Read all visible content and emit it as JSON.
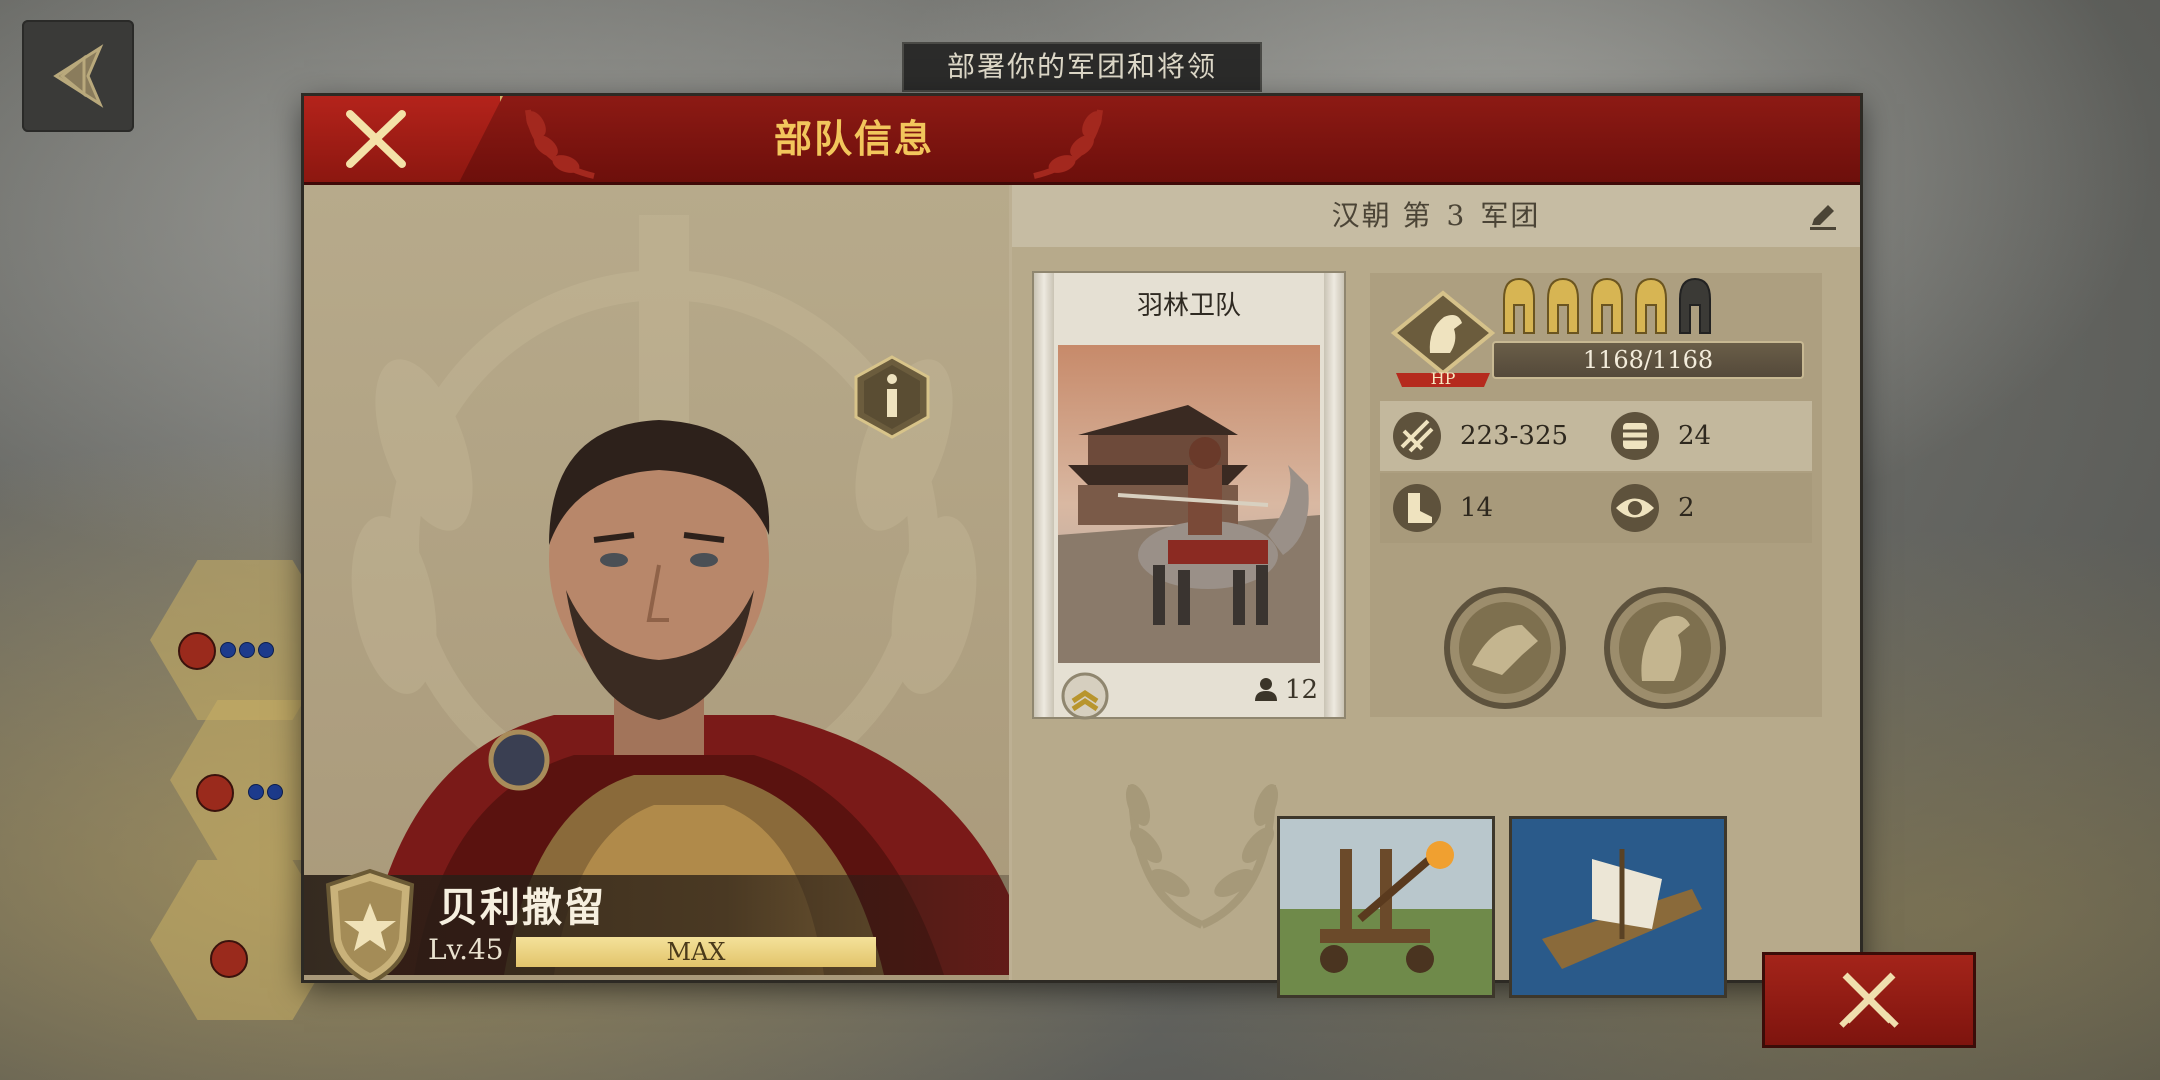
{
  "screen": {
    "banner_title": "部署你的军团和将领"
  },
  "dialog": {
    "title": "部队信息",
    "legion_prefix": "汉朝 第",
    "legion_number": "3",
    "legion_suffix": "军团"
  },
  "hero": {
    "name": "贝利撒留",
    "level_text": "Lv.45",
    "exp_text": "MAX",
    "exp_fraction": 1.0
  },
  "unit_card": {
    "name": "羽林卫队",
    "count": "12",
    "rank_icon": "chevron-rank-icon"
  },
  "unit_stats": {
    "hp_label": "HP",
    "hp_text": "1168/1168",
    "stars_filled": 4,
    "stars_total": 5,
    "attack": "223-325",
    "defense": "24",
    "speed": "14",
    "range": "2"
  },
  "colors": {
    "header_red": "#8d1a14",
    "title_gold": "#f2c65c",
    "panel_tan": "#b7aa8b"
  },
  "icons": {
    "back": "back-arrow-icon",
    "close": "close-icon",
    "info": "info-icon",
    "edit": "pencil-icon",
    "attack": "crossed-swords-icon"
  }
}
